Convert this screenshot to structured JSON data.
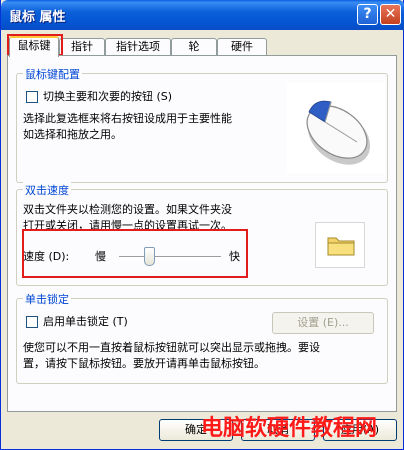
{
  "window": {
    "title": "鼠标 属性",
    "help_glyph": "?",
    "close_glyph": "✕"
  },
  "tabs": [
    {
      "label": "鼠标键",
      "active": true
    },
    {
      "label": "指针",
      "active": false
    },
    {
      "label": "指针选项",
      "active": false
    },
    {
      "label": "轮",
      "active": false
    },
    {
      "label": "硬件",
      "active": false
    }
  ],
  "button_config": {
    "title": "鼠标键配置",
    "swap_label": "切换主要和次要的按钮 (S)",
    "swap_checked": false,
    "description_line1": "选择此复选框来将右按钮设成用于主要性能",
    "description_line2": "如选择和拖放之用。"
  },
  "double_click": {
    "title": "双击速度",
    "description_line1": "双击文件夹以检测您的设置。如果文件夹没",
    "description_line2": "打开或关闭，请用慢一点的设置再试一次。",
    "speed_label": "速度 (D):",
    "slow_label": "慢",
    "fast_label": "快",
    "speed_fraction": 0.28
  },
  "click_lock": {
    "title": "单击锁定",
    "enable_label": "启用单击锁定 (T)",
    "enable_checked": false,
    "settings_label": "设置 (E)...",
    "description_line1": "使您可以不用一直按着鼠标按钮就可以突出显示或拖拽。要设",
    "description_line2": "置，请按下鼠标按钮。要放开请再单击鼠标按钮。"
  },
  "footer": {
    "ok": "确定",
    "cancel": "取消",
    "apply": "应用(A)"
  },
  "watermark": "电脑软硬件教程网",
  "colors": {
    "titlebar": "#0454d2",
    "group_title": "#0046d5",
    "highlight": "#e21b1b",
    "watermark": "#ff1a1a"
  },
  "icons": {
    "mouse": "mouse-illustration-icon",
    "folder": "folder-icon"
  }
}
